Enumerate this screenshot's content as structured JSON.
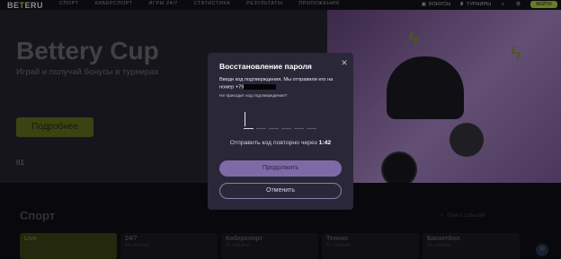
{
  "nav": {
    "items": [
      "СПОРТ",
      "КИБЕРСПОРТ",
      "ИГРЫ 24/7",
      "СТАТИСТИКА",
      "РЕЗУЛЬТАТЫ",
      "ПРИЛОЖЕНИЯ"
    ],
    "bonus_label": "БОНУСЫ",
    "tournaments_label": "ТУРНИРЫ",
    "login_label": "ВОЙТИ"
  },
  "hero": {
    "title": "Bettery Cup",
    "subtitle": "Играй и получай бонусы в турнирах",
    "button_label": "Подробнее",
    "counter": "01"
  },
  "sport": {
    "title": "Спорт",
    "search_label": "Поиск событий",
    "cards": [
      {
        "title": "Live",
        "count": "243 события"
      },
      {
        "title": "24/7",
        "count": "54 события"
      },
      {
        "title": "Киберспорт",
        "count": "54 события"
      },
      {
        "title": "Теннис",
        "count": "87 событий"
      },
      {
        "title": "Баскетбол",
        "count": "63 события"
      }
    ]
  },
  "modal": {
    "title": "Восстановление пароля",
    "description": "Введи код подтверждения. Мы отправили его на номер +79",
    "resend_link": "Не приходит код подтверждения?",
    "timer_label": "Отправить код повторно через",
    "timer_value": "1:42",
    "continue_label": "Продолжить",
    "cancel_label": "Отменить"
  },
  "colors": {
    "accent": "#c2e04a",
    "modal_bg": "#2a2838",
    "primary_button": "#7f6aa8"
  }
}
